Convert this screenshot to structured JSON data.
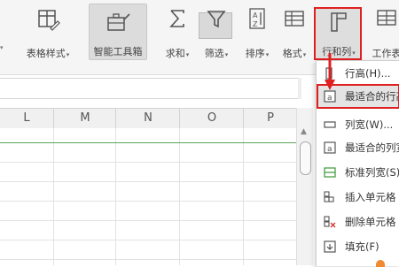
{
  "ribbon": {
    "table_style_label": "表格样式",
    "smart_toolbox_label": "智能工具箱",
    "sum_label": "求和",
    "filter_label": "筛选",
    "sort_label": "排序",
    "format_label": "格式",
    "row_col_label": "行和列",
    "worksheet_label": "工作表"
  },
  "columns": [
    "L",
    "M",
    "N",
    "O",
    "P"
  ],
  "menu": {
    "items": [
      {
        "label": "行高(H)...",
        "icon": "row-height-icon"
      },
      {
        "label": "最适合的行高",
        "icon": "best-fit-row-icon"
      },
      {
        "label": "列宽(W)...",
        "icon": "column-width-icon"
      },
      {
        "label": "最适合的列宽",
        "icon": "best-fit-column-icon"
      },
      {
        "label": "标准列宽(S)...",
        "icon": "standard-width-icon"
      },
      {
        "label": "插入单元格",
        "icon": "insert-cells-icon"
      },
      {
        "label": "删除单元格",
        "icon": "delete-cells-icon"
      },
      {
        "label": "填充(F)",
        "icon": "fill-icon"
      }
    ]
  },
  "colors": {
    "highlight": "#e02020",
    "grid_accent": "#5aa55a"
  }
}
